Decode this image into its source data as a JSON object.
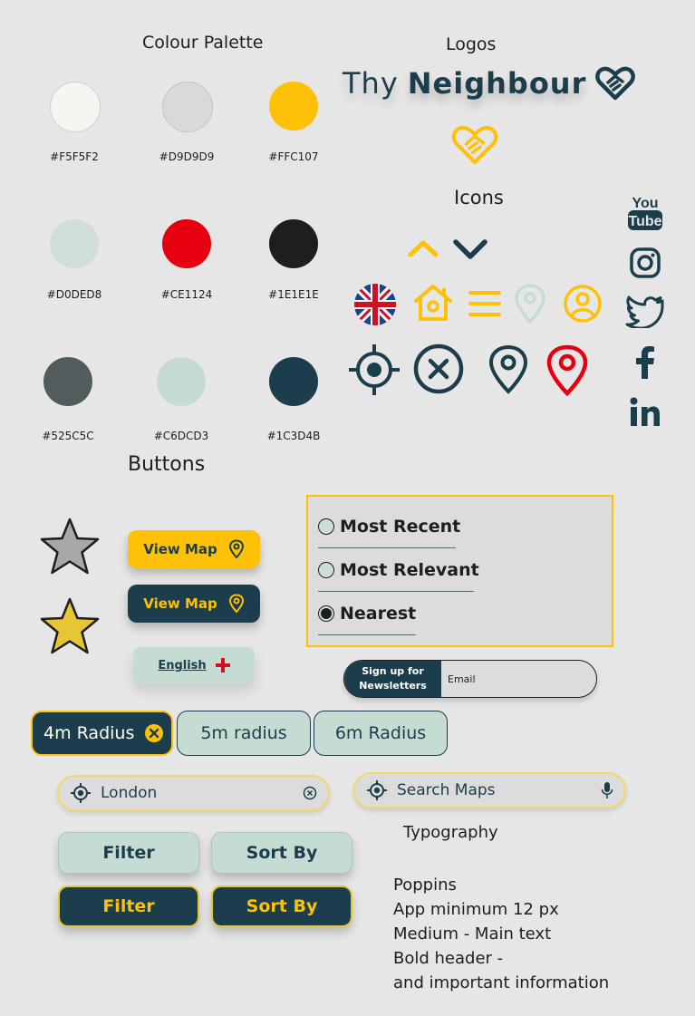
{
  "sections": {
    "colour_palette": "Colour Palette",
    "logos": "Logos",
    "icons": "Icons",
    "buttons": "Buttons",
    "typography": "Typography"
  },
  "palette": [
    {
      "hex": "#F5F5F2",
      "label": "#F5F5F2"
    },
    {
      "hex": "#D9D9D9",
      "label": "#D9D9D9"
    },
    {
      "hex": "#FFC107",
      "label": "#FFC107"
    },
    {
      "hex": "#D0DED8",
      "label": "#D0DED8"
    },
    {
      "hex": "#CE1124",
      "label": "#CE1124"
    },
    {
      "hex": "#1E1E1E",
      "label": "#1E1E1E"
    },
    {
      "hex": "#525C5C",
      "label": "#525C5C"
    },
    {
      "hex": "#C6DCD3",
      "label": "#C6DCD3"
    },
    {
      "hex": "#1C3D4B",
      "label": "#1C3D4B"
    }
  ],
  "logo": {
    "thin": "Thy",
    "bold": "Neighbour"
  },
  "icons": {
    "row1": [
      "chevron-up-icon",
      "chevron-down-icon"
    ],
    "row2": [
      "uk-flag-icon",
      "home-icon",
      "menu-icon",
      "location-pin-outline-icon",
      "user-icon"
    ],
    "row3": [
      "crosshair-icon",
      "close-circle-icon",
      "location-pin-icon",
      "location-pin-red-icon"
    ],
    "social": [
      "youtube-icon",
      "instagram-icon",
      "twitter-icon",
      "facebook-icon",
      "linkedin-icon"
    ]
  },
  "buttons": {
    "view_map_yellow": "View Map",
    "view_map_dark": "View Map",
    "english": "English",
    "newsletter_line1": "Sign up for",
    "newsletter_line2": "Newsletters",
    "email_placeholder": "Email",
    "filter_light": "Filter",
    "sort_light": "Sort By",
    "filter_dark": "Filter",
    "sort_dark": "Sort By"
  },
  "sort_options": [
    {
      "label": "Most Recent",
      "selected": false
    },
    {
      "label": "Most Relevant",
      "selected": false
    },
    {
      "label": "Nearest",
      "selected": true
    }
  ],
  "chips": [
    {
      "label": "4m Radius",
      "active": true
    },
    {
      "label": "5m radius",
      "active": false
    },
    {
      "label": "6m Radius",
      "active": false
    }
  ],
  "location_field": {
    "value": "London"
  },
  "search_field": {
    "placeholder": "Search Maps"
  },
  "typography_lines": [
    "Poppins",
    "App minimum 12 px",
    "Medium - Main text",
    "Bold header -",
    "and important information"
  ],
  "colors": {
    "accent": "#FFC107",
    "dark": "#1C3D4B",
    "red": "#CE1124",
    "mint": "#C6DCD3"
  }
}
